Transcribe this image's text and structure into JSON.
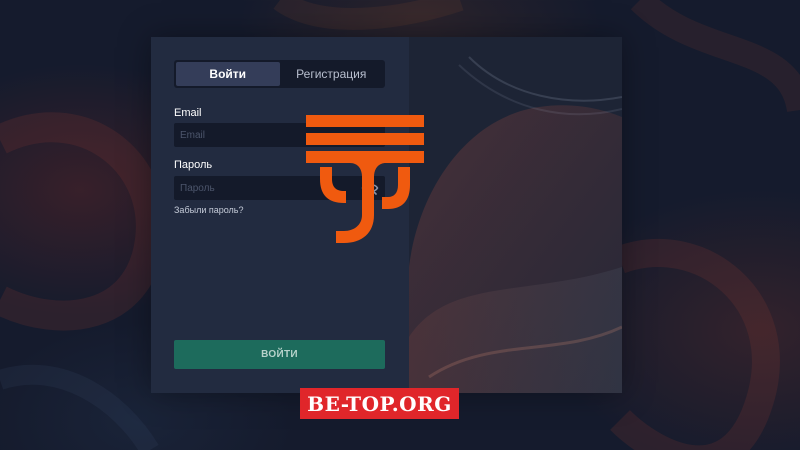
{
  "auth": {
    "tabs": [
      {
        "label": "Войти",
        "active": true
      },
      {
        "label": "Регистрация",
        "active": false
      }
    ],
    "email": {
      "label": "Email",
      "placeholder": "Email",
      "value": ""
    },
    "password": {
      "label": "Пароль",
      "placeholder": "Пароль",
      "value": "",
      "toggle_icon": "eye-off-icon"
    },
    "forgot_link": "Забыли пароль?",
    "submit_label": "ВОЙТИ"
  },
  "brand": {
    "logo_icon": "ts-logo-icon",
    "logo_color": "#f05a0f"
  },
  "watermark": {
    "text": "BE-TOP.ORG",
    "color": "#e0262a"
  },
  "colors": {
    "background": "#151b2d",
    "form_panel": "#222b40",
    "input_bg": "#141a2a",
    "active_tab": "#343d59",
    "submit_button": "#1d6b5c"
  }
}
